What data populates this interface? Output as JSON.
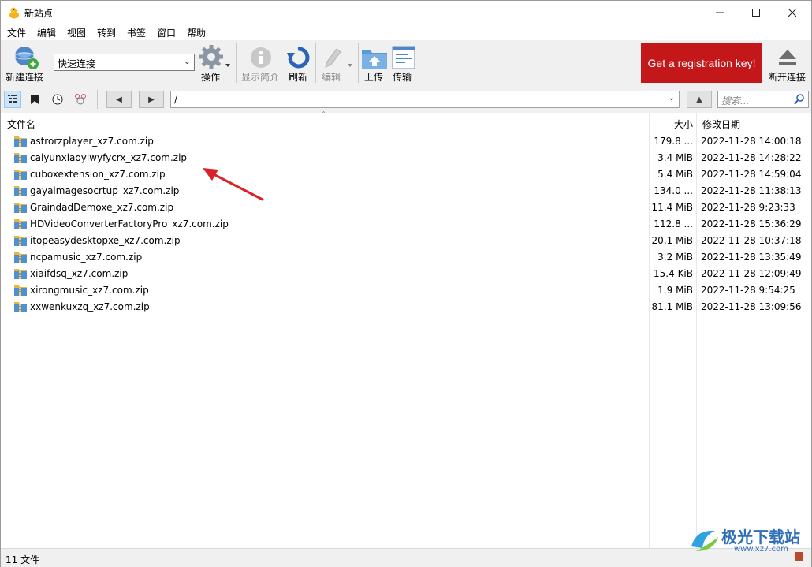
{
  "window": {
    "title": "新站点"
  },
  "menu": [
    "文件",
    "编辑",
    "视图",
    "转到",
    "书签",
    "窗口",
    "帮助"
  ],
  "toolbar": {
    "new_connection": "新建连接",
    "quick_connect_value": "快速连接",
    "action": "操作",
    "info": "显示简介",
    "refresh": "刷新",
    "edit": "编辑",
    "upload": "上传",
    "transfers": "传输",
    "registration": "Get a registration key!",
    "disconnect": "断开连接"
  },
  "nav": {
    "path": "/",
    "search_placeholder": "搜索..."
  },
  "columns": {
    "name": "文件名",
    "size": "大小",
    "modified": "修改日期"
  },
  "files": [
    {
      "name": "astrorzplayer_xz7.com.zip",
      "size": "179.8 ...",
      "modified": "2022-11-28 14:00:18"
    },
    {
      "name": "caiyunxiaoyiwyfycrx_xz7.com.zip",
      "size": "3.4 MiB",
      "modified": "2022-11-28 14:28:22"
    },
    {
      "name": "cuboxextension_xz7.com.zip",
      "size": "5.4 MiB",
      "modified": "2022-11-28 14:59:04"
    },
    {
      "name": "gayaimagesocrtup_xz7.com.zip",
      "size": "134.0 ...",
      "modified": "2022-11-28 11:38:13"
    },
    {
      "name": "GraindadDemoxe_xz7.com.zip",
      "size": "11.4 MiB",
      "modified": "2022-11-28 9:23:33"
    },
    {
      "name": "HDVideoConverterFactoryPro_xz7.com.zip",
      "size": "112.8 ...",
      "modified": "2022-11-28 15:36:29"
    },
    {
      "name": "itopeasydesktopxe_xz7.com.zip",
      "size": "20.1 MiB",
      "modified": "2022-11-28 10:37:18"
    },
    {
      "name": "ncpamusic_xz7.com.zip",
      "size": "3.2 MiB",
      "modified": "2022-11-28 13:35:49"
    },
    {
      "name": "xiaifdsq_xz7.com.zip",
      "size": "15.4 KiB",
      "modified": "2022-11-28 12:09:49"
    },
    {
      "name": "xirongmusic_xz7.com.zip",
      "size": "1.9 MiB",
      "modified": "2022-11-28 9:54:25"
    },
    {
      "name": "xxwenkuxzq_xz7.com.zip",
      "size": "81.1 MiB",
      "modified": "2022-11-28 13:09:56"
    }
  ],
  "status": {
    "text": "11 文件"
  },
  "watermark": {
    "text": "极光下载站",
    "url": "www.xz7.com"
  },
  "colors": {
    "accent_red": "#c4171a",
    "arrow": "#d9232a"
  }
}
